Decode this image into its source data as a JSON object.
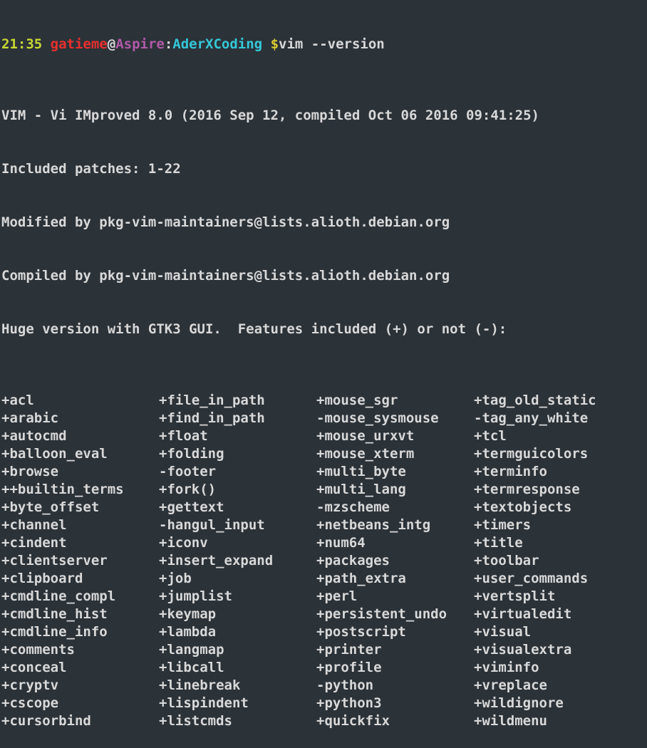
{
  "prompt": {
    "time": "21:35",
    "user": "gatieme",
    "at": "@",
    "host": "Aspire",
    "colon": ":",
    "path": "AderXCoding",
    "dollar": "$",
    "command": "vim --version"
  },
  "colors": {
    "background": "#2b3238",
    "text": "#d8d8d8",
    "time": "#c8d832",
    "user": "#e8302e",
    "host": "#b05aa8",
    "path": "#34c8d8",
    "dollar": "#d8c832"
  },
  "header_lines": [
    "VIM - Vi IMproved 8.0 (2016 Sep 12, compiled Oct 06 2016 09:41:25)",
    "Included patches: 1-22",
    "Modified by pkg-vim-maintainers@lists.alioth.debian.org",
    "Compiled by pkg-vim-maintainers@lists.alioth.debian.org",
    "Huge version with GTK3 GUI.  Features included (+) or not (-):"
  ],
  "features": [
    [
      "+acl",
      "+file_in_path",
      "+mouse_sgr",
      "+tag_old_static"
    ],
    [
      "+arabic",
      "+find_in_path",
      "-mouse_sysmouse",
      "-tag_any_white"
    ],
    [
      "+autocmd",
      "+float",
      "+mouse_urxvt",
      "+tcl"
    ],
    [
      "+balloon_eval",
      "+folding",
      "+mouse_xterm",
      "+termguicolors"
    ],
    [
      "+browse",
      "-footer",
      "+multi_byte",
      "+terminfo"
    ],
    [
      "++builtin_terms",
      "+fork()",
      "+multi_lang",
      "+termresponse"
    ],
    [
      "+byte_offset",
      "+gettext",
      "-mzscheme",
      "+textobjects"
    ],
    [
      "+channel",
      "-hangul_input",
      "+netbeans_intg",
      "+timers"
    ],
    [
      "+cindent",
      "+iconv",
      "+num64",
      "+title"
    ],
    [
      "+clientserver",
      "+insert_expand",
      "+packages",
      "+toolbar"
    ],
    [
      "+clipboard",
      "+job",
      "+path_extra",
      "+user_commands"
    ],
    [
      "+cmdline_compl",
      "+jumplist",
      "+perl",
      "+vertsplit"
    ],
    [
      "+cmdline_hist",
      "+keymap",
      "+persistent_undo",
      "+virtualedit"
    ],
    [
      "+cmdline_info",
      "+lambda",
      "+postscript",
      "+visual"
    ],
    [
      "+comments",
      "+langmap",
      "+printer",
      "+visualextra"
    ],
    [
      "+conceal",
      "+libcall",
      "+profile",
      "+viminfo"
    ],
    [
      "+cryptv",
      "+linebreak",
      "-python",
      "+vreplace"
    ],
    [
      "+cscope",
      "+lispindent",
      "+python3",
      "+wildignore"
    ],
    [
      "+cursorbind",
      "+listcmds",
      "+quickfix",
      "+wildmenu"
    ]
  ]
}
